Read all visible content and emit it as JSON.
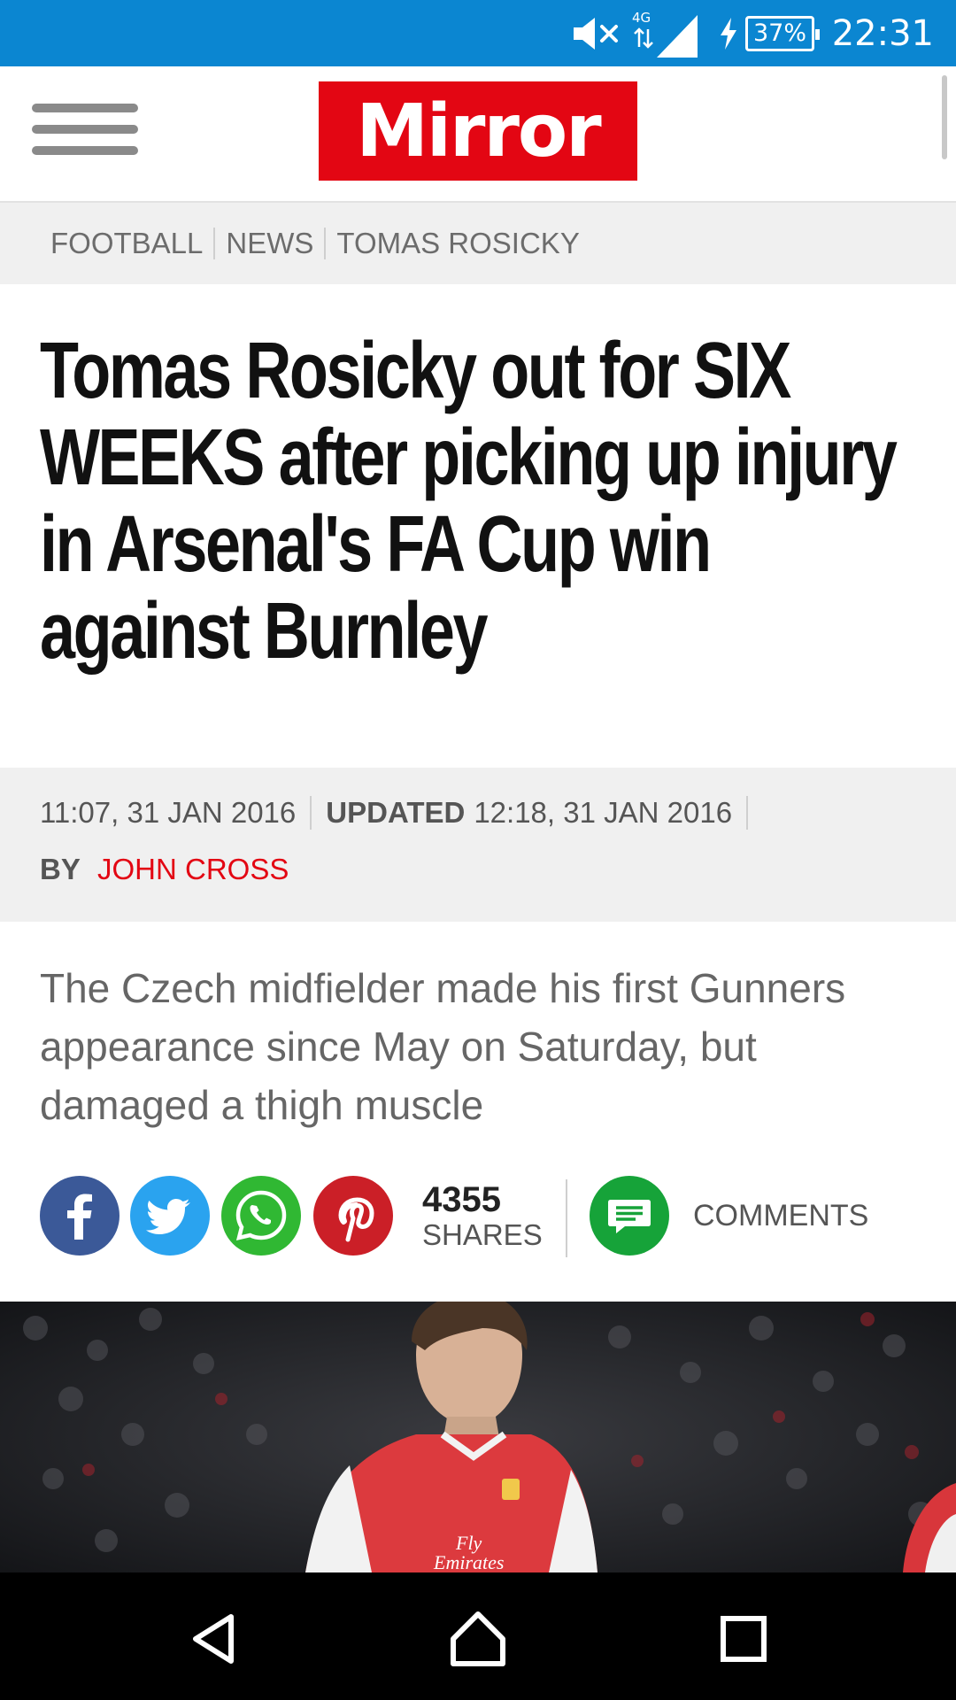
{
  "status_bar": {
    "time": "22:31",
    "battery": "37%",
    "network": "4G",
    "icons": [
      "mute-icon",
      "signal-icon",
      "charging-icon",
      "battery-icon"
    ]
  },
  "header": {
    "logo_text": "Mirror",
    "menu_icon": "hamburger-menu-icon"
  },
  "breadcrumb": [
    "FOOTBALL",
    "NEWS",
    "TOMAS ROSICKY"
  ],
  "article": {
    "headline": "Tomas Rosicky out for SIX WEEKS after picking up injury in Arsenal's FA Cup win against Burnley",
    "published": "11:07, 31 JAN 2016",
    "updated_label": "UPDATED",
    "updated": "12:18, 31 JAN 2016",
    "by_label": "BY",
    "author": "JOHN CROSS",
    "standfirst": "The Czech midfielder made his first Gunners appearance since May on Saturday, but damaged a thigh muscle"
  },
  "share": {
    "count": "4355",
    "shares_label": "SHARES",
    "comments_label": "COMMENTS",
    "buttons": [
      "facebook-icon",
      "twitter-icon",
      "whatsapp-icon",
      "pinterest-icon",
      "comments-icon"
    ]
  },
  "photo": {
    "shirt_text_1": "Fly",
    "shirt_text_2": "Emirates"
  },
  "colors": {
    "status_bar": "#0b86d1",
    "brand_red": "#e30613",
    "facebook": "#3b5998",
    "twitter": "#2aa3ef",
    "whatsapp": "#30b833",
    "pinterest": "#cb1f27",
    "comments": "#16a339"
  },
  "navigation": [
    "back-icon",
    "home-icon",
    "recents-icon"
  ]
}
